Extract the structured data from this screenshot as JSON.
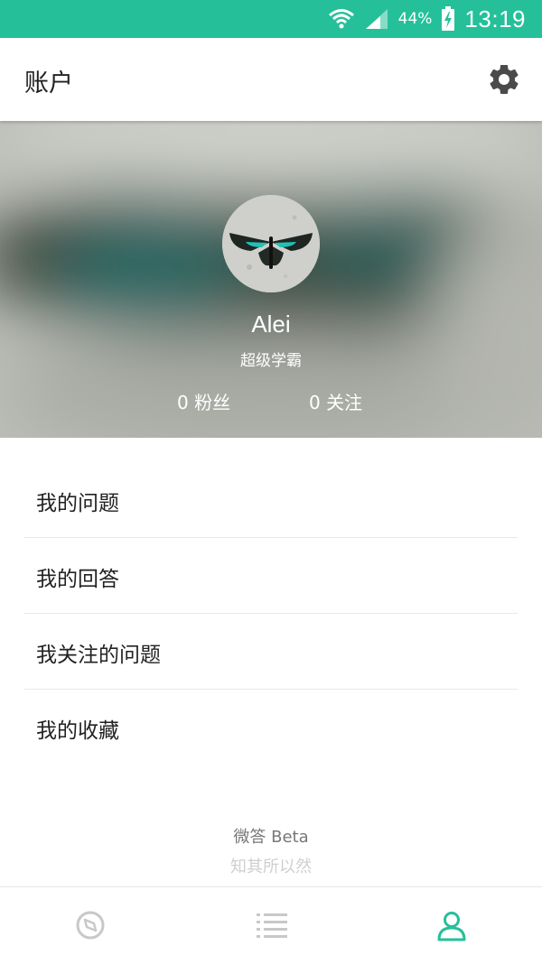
{
  "status_bar": {
    "battery_percent": "44%",
    "time": "13:19",
    "icons": [
      "wifi-icon",
      "signal-icon",
      "battery-charging-icon"
    ],
    "color": "#25c09a"
  },
  "header": {
    "title": "账户",
    "settings_icon": "gear-icon"
  },
  "profile": {
    "name": "Alei",
    "subtitle": "超级学霸",
    "followers": "0 粉丝",
    "following": "0 关注"
  },
  "menu": {
    "items": [
      {
        "label": "我的问题"
      },
      {
        "label": "我的回答"
      },
      {
        "label": "我关注的问题"
      },
      {
        "label": "我的收藏"
      }
    ]
  },
  "footer": {
    "brand": "微答 Beta",
    "slogan": "知其所以然"
  },
  "bottom_nav": {
    "items": [
      {
        "icon": "compass-icon",
        "active": false
      },
      {
        "icon": "list-icon",
        "active": false
      },
      {
        "icon": "person-icon",
        "active": true
      }
    ],
    "active_color": "#25c09a",
    "inactive_color": "#c8c8c8"
  }
}
